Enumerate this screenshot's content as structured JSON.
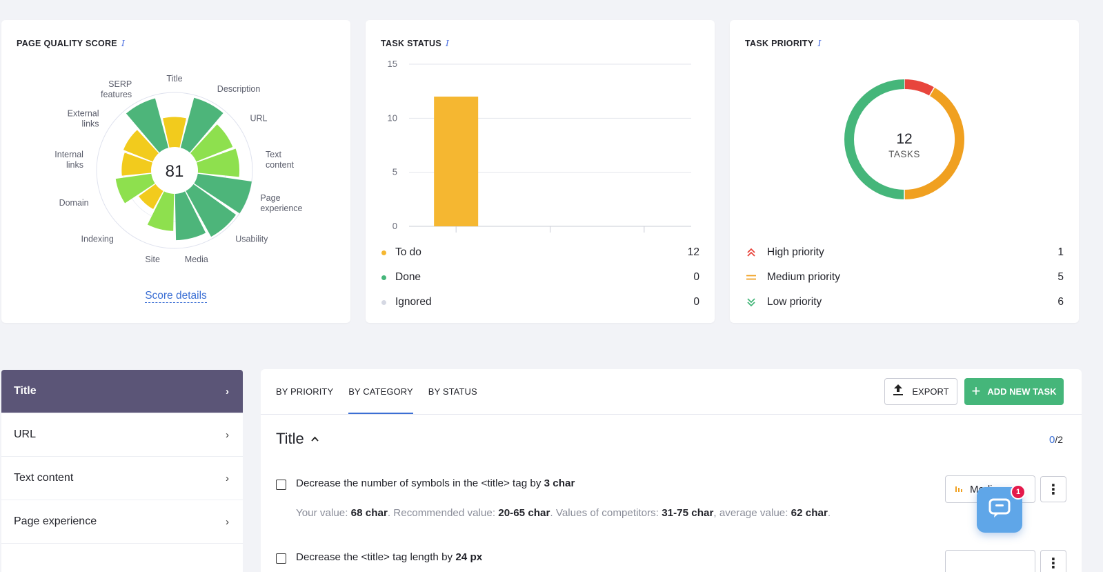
{
  "cards": {
    "quality": {
      "title": "PAGE QUALITY SCORE",
      "info_icon": "info-icon",
      "score": "81",
      "score_link": "Score details",
      "segments": [
        {
          "label": "Title",
          "value": 0.55,
          "color": "#f2cb1d"
        },
        {
          "label": "Description",
          "value": 0.95,
          "color": "#4db57a"
        },
        {
          "label": "URL",
          "value": 0.72,
          "color": "#8ee04e"
        },
        {
          "label": "Text content",
          "value": 0.76,
          "color": "#8ee04e"
        },
        {
          "label": "Page experience",
          "value": 1.0,
          "color": "#4db57a"
        },
        {
          "label": "Usability",
          "value": 0.96,
          "color": "#4db57a"
        },
        {
          "label": "Media",
          "value": 0.85,
          "color": "#4db57a"
        },
        {
          "label": "Site",
          "value": 0.68,
          "color": "#8ee04e"
        },
        {
          "label": "Indexing",
          "value": 0.38,
          "color": "#f2cb1d"
        },
        {
          "label": "Domain",
          "value": 0.66,
          "color": "#8ee04e"
        },
        {
          "label": "Internal links",
          "value": 0.54,
          "color": "#f2cb1d"
        },
        {
          "label": "External links",
          "value": 0.58,
          "color": "#f2cb1d"
        },
        {
          "label": "SERP features",
          "value": 0.94,
          "color": "#4db57a"
        }
      ]
    },
    "status": {
      "title": "TASK STATUS",
      "legend": [
        {
          "label": "To do",
          "value": "12",
          "color": "#f5b731"
        },
        {
          "label": "Done",
          "value": "0",
          "color": "#45b67a"
        },
        {
          "label": "Ignored",
          "value": "0",
          "color": "#d5d8e3"
        }
      ]
    },
    "priority": {
      "title": "TASK PRIORITY",
      "center_value": "12",
      "center_label": "TASKS",
      "legend": [
        {
          "label": "High priority",
          "value": "1",
          "icon": "double-chevron-up-icon",
          "color": "#e8453c"
        },
        {
          "label": "Medium priority",
          "value": "5",
          "icon": "equals-icon",
          "color": "#f0a020"
        },
        {
          "label": "Low priority",
          "value": "6",
          "icon": "double-chevron-down-icon",
          "color": "#45b67a"
        }
      ]
    }
  },
  "chart_data": [
    {
      "type": "bar",
      "categories": [
        "To do",
        "Done",
        "Ignored"
      ],
      "values": [
        12,
        0,
        0
      ],
      "ylim": [
        0,
        15
      ],
      "yticks": [
        "0",
        "5",
        "10",
        "15"
      ],
      "grid": true,
      "color": "#f5b731"
    },
    {
      "type": "pie",
      "categories": [
        "High priority",
        "Medium priority",
        "Low priority"
      ],
      "values": [
        1,
        5,
        6
      ],
      "colors": [
        "#e8453c",
        "#f0a020",
        "#45b67a"
      ]
    }
  ],
  "sidebar": {
    "items": [
      {
        "label": "Title",
        "active": true
      },
      {
        "label": "URL"
      },
      {
        "label": "Text content"
      },
      {
        "label": "Page experience"
      }
    ]
  },
  "panel": {
    "tabs": [
      "BY PRIORITY",
      "BY CATEGORY",
      "BY STATUS"
    ],
    "active_tab": 1,
    "export_label": "EXPORT",
    "add_label": "ADD NEW TASK",
    "section_title": "Title",
    "counter_done": "0",
    "counter_total": "/2",
    "tasks": [
      {
        "text_before": "Decrease the number of symbols in the <title> tag by ",
        "text_bold": "3 char",
        "sub": {
          "l1": "Your value: ",
          "v1": "68 char",
          "l2": ". Recommended value: ",
          "v2": "20-65 char",
          "l3": ". Values of competitors: ",
          "v3": "31-75 char",
          "l4": ", average value: ",
          "v4": "62 char",
          "end": "."
        },
        "priority": "Medium"
      },
      {
        "text_before": "Decrease the <title> tag length by ",
        "text_bold": "24 px"
      }
    ]
  },
  "chat": {
    "badge": "1"
  }
}
